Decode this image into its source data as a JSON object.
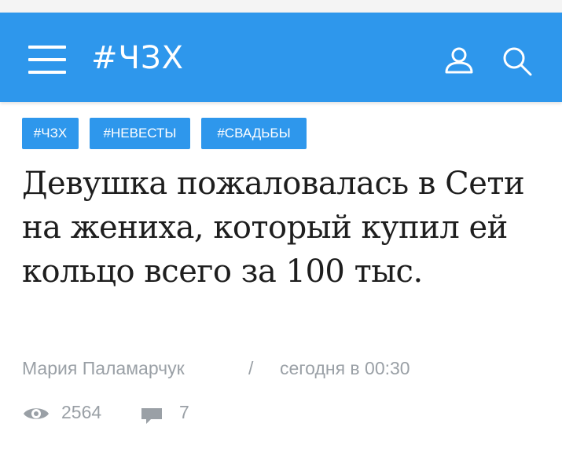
{
  "header": {
    "site_title": "#ЧЗХ",
    "bg_color": "#2e97ec",
    "icons": [
      "menu-icon",
      "user-icon",
      "search-icon"
    ]
  },
  "tags": [
    {
      "label": "#ЧЗХ"
    },
    {
      "label": "#НЕВЕСТЫ"
    },
    {
      "label": "#СВАДЬБЫ"
    }
  ],
  "article": {
    "title": "Девушка пожаловалась в Сети на жениха, который купил ей кольцо всего за 100 тыс.",
    "author": "Мария Паламарчук",
    "separator": "/",
    "date": "сегодня в 00:30",
    "views": "2564",
    "comments": "7"
  }
}
